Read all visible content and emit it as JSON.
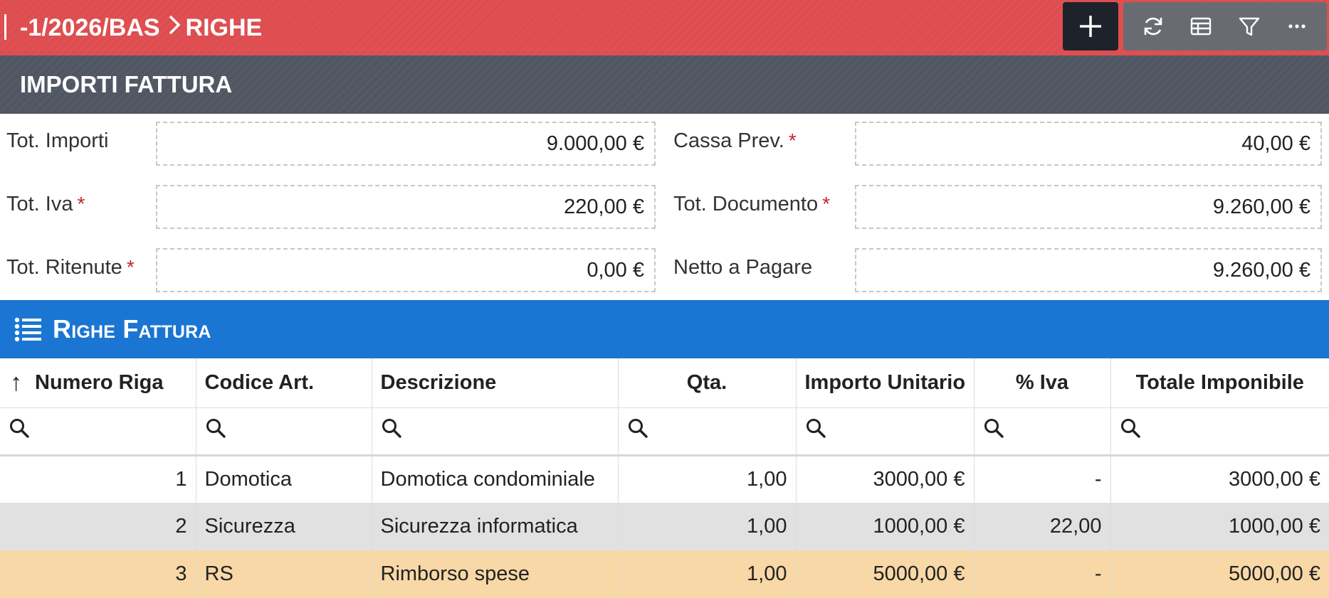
{
  "header": {
    "breadcrumb_doc": "-1/2026/BAS",
    "breadcrumb_section": "RIGHE",
    "actions": [
      {
        "name": "add",
        "icon": "plus-icon"
      },
      {
        "name": "refresh",
        "icon": "refresh-icon"
      },
      {
        "name": "table-view",
        "icon": "table-icon"
      },
      {
        "name": "filter",
        "icon": "filter-icon"
      },
      {
        "name": "more",
        "icon": "more-icon"
      }
    ],
    "colors": {
      "bar": "#de4d4f",
      "add_button": "#1e232b",
      "tool_group": "#686c72"
    }
  },
  "importi": {
    "title": "IMPORTI FATTURA",
    "fields": {
      "tot_importi": {
        "label": "Tot. Importi",
        "value": "9.000,00 €",
        "required": false
      },
      "cassa_prev": {
        "label": "Cassa Prev.",
        "value": "40,00 €",
        "required": true
      },
      "tot_iva": {
        "label": "Tot. Iva",
        "value": "220,00 €",
        "required": true
      },
      "tot_documento": {
        "label": "Tot. Documento",
        "value": "9.260,00 €",
        "required": true
      },
      "tot_ritenute": {
        "label": "Tot. Ritenute",
        "value": "0,00 €",
        "required": true
      },
      "netto_pagare": {
        "label": "Netto a Pagare",
        "value": "9.260,00 €",
        "required": false
      }
    },
    "required_mark": "*"
  },
  "righe": {
    "title": "Righe Fattura",
    "icon": "list-icon",
    "columns": [
      "Numero Riga",
      "Codice Art.",
      "Descrizione",
      "Qta.",
      "Importo Unitario",
      "% Iva",
      "Totale Imponibile"
    ],
    "sort_icon": "↑",
    "rows": [
      [
        "1",
        "Domotica",
        "Domotica condominiale",
        "1,00",
        "3000,00 €",
        "-",
        "3000,00 €"
      ],
      [
        "2",
        "Sicurezza",
        "Sicurezza informatica",
        "1,00",
        "1000,00 €",
        "22,00",
        "1000,00 €"
      ],
      [
        "3",
        "RS",
        "Rimborso spese",
        "1,00",
        "5000,00 €",
        "-",
        "5000,00 €"
      ]
    ],
    "row_colors": [
      "#ffffff",
      "#e1e1e1",
      "#f8d8a6"
    ]
  }
}
